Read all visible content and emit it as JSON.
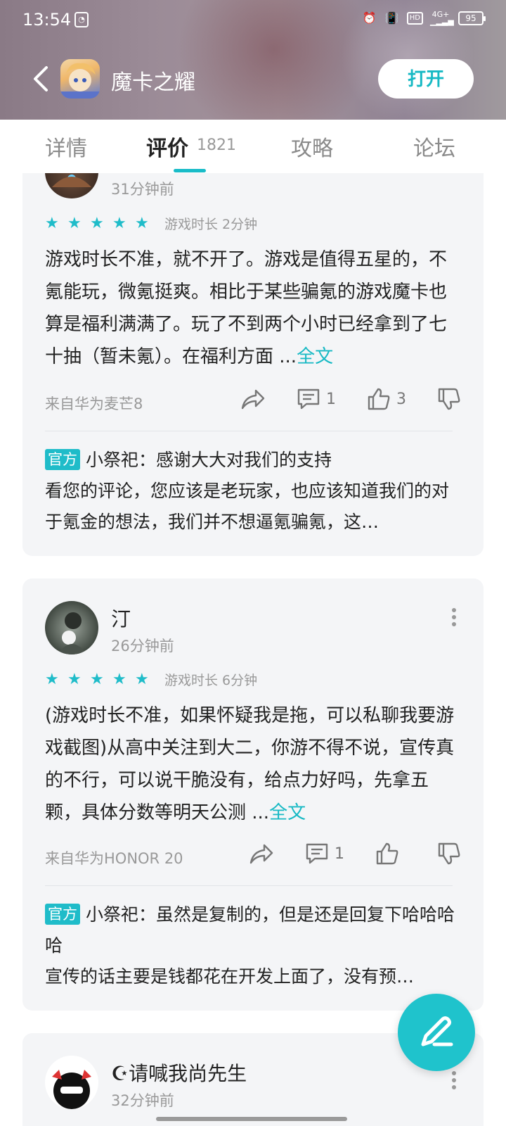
{
  "status_bar": {
    "time": "13:54",
    "network": "4G+",
    "hd": "HD",
    "battery": "95"
  },
  "header": {
    "game_title": "魔卡之耀",
    "open_label": "打开"
  },
  "tabs": [
    {
      "label": "详情"
    },
    {
      "label": "评价",
      "count": "1821"
    },
    {
      "label": "攻略"
    },
    {
      "label": "论坛"
    }
  ],
  "reviews": [
    {
      "time": "31分钟前",
      "playtime": "游戏时长 2分钟",
      "text": "游戏时长不准，就不开了。游戏是值得五星的，不氪能玩，微氪挺爽。相比于某些骗氪的游戏魔卡也算是福利满满了。玩了不到两个小时已经拿到了七十抽（暂未氪）。在福利方面 ...",
      "full_label": "全文",
      "device": "来自华为麦芒8",
      "comment_count": "1",
      "like_count": "3",
      "rating": 5,
      "reply": {
        "badge": "官方",
        "author_line": "小祭祀：感谢大大对我们的支持",
        "text": "看您的评论，您应该是老玩家，也应该知道我们的对于氪金的想法，我们并不想逼氪骗氪，这…"
      }
    },
    {
      "username": "汀",
      "time": "26分钟前",
      "playtime": "游戏时长 6分钟",
      "text": "(游戏时长不准，如果怀疑我是拖，可以私聊我要游戏截图)从高中关注到大二，你游不得不说，宣传真的不行，可以说干脆没有，给点力好吗，先拿五颗，具体分数等明天公测 ...",
      "full_label": "全文",
      "device": "来自华为HONOR 20",
      "comment_count": "1",
      "like_count": "",
      "rating": 5,
      "reply": {
        "badge": "官方",
        "author_line": "小祭祀：虽然是复制的，但是还是回复下哈哈哈哈",
        "text": "宣传的话主要是钱都花在开发上面了，没有预…"
      }
    },
    {
      "username": "☪请喊我尚先生",
      "time": "32分钟前"
    }
  ],
  "colors": {
    "accent": "#1fbcc9",
    "card_bg": "#f4f5f7",
    "muted": "#999999"
  }
}
